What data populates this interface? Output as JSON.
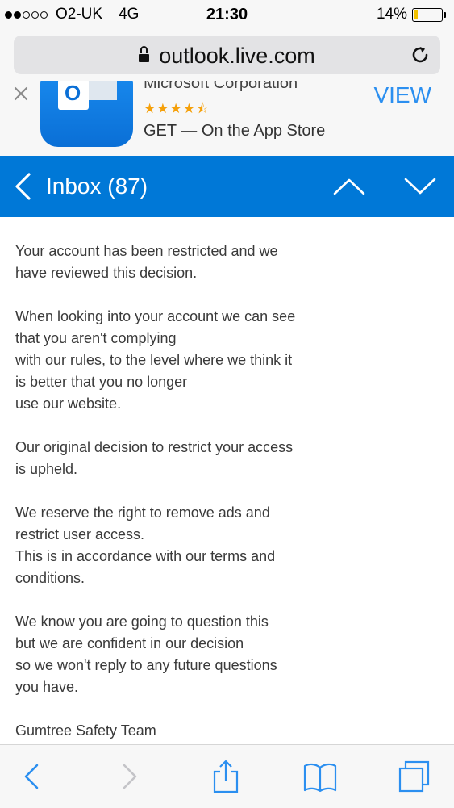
{
  "status_bar": {
    "signal_filled": 2,
    "signal_total": 5,
    "carrier": "O2-UK",
    "network": "4G",
    "time": "21:30",
    "battery_percent_text": "14%",
    "battery_level": 0.14,
    "battery_color": "#f2c200"
  },
  "browser": {
    "url": "outlook.live.com"
  },
  "app_banner": {
    "publisher": "Microsoft Corporation",
    "rating": 4.5,
    "rating_stars": "★★★★⯪",
    "store_line": "GET — On the App Store",
    "view_label": "VIEW"
  },
  "header": {
    "back_title": "Inbox (87)",
    "accent_color": "#0078d7"
  },
  "message": {
    "paragraphs": [
      [
        "Your account has been restricted and we",
        "have reviewed this decision."
      ],
      [
        "When looking into your account we can see",
        "that you aren't complying",
        "with our rules, to the level where we think it",
        "is better that you no longer",
        "use our website."
      ],
      [
        "Our original decision to restrict your access",
        "is upheld."
      ],
      [
        "We reserve the right to remove ads and",
        "restrict user access.",
        "This is in accordance with our terms and",
        "conditions."
      ],
      [
        "We know you are going to question this",
        "but we are confident in our decision",
        "so we won't reply to any future questions",
        "you have."
      ],
      [
        "Gumtree Safety Team"
      ]
    ]
  },
  "toolbar": {
    "icons": [
      "back-icon",
      "forward-icon",
      "share-icon",
      "bookmarks-icon",
      "tabs-icon"
    ],
    "icon_color": "#2b8ff0"
  }
}
